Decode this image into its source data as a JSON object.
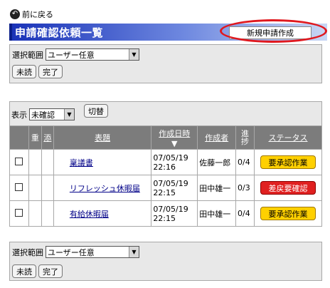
{
  "nav": {
    "back_label": "前に戻る"
  },
  "header": {
    "title": "申請確認依頼一覧",
    "new_button": "新規申請作成"
  },
  "top_panel": {
    "range_label": "選択範囲",
    "range_value": "ユーザー任意",
    "unread_button": "未読",
    "done_button": "完了"
  },
  "filter": {
    "label": "表示",
    "value": "未確認",
    "switch_button": "切替"
  },
  "table": {
    "headers": {
      "important": "重",
      "attach": "添",
      "subject": "表題",
      "created": "作成日時",
      "author": "作成者",
      "progress": "進捗",
      "status": "ステータス"
    },
    "rows": [
      {
        "subject": "稟議書",
        "date": "07/05/19",
        "time": "22:16",
        "author": "佐藤一郎",
        "progress": "0/4",
        "status": "要承認作業",
        "status_color": "#ffd000"
      },
      {
        "subject": "リフレッシュ休暇届",
        "date": "07/05/19",
        "time": "22:15",
        "author": "田中雄一",
        "progress": "0/3",
        "status": "差戻要確認",
        "status_color": "#e02020"
      },
      {
        "subject": "有給休暇届",
        "date": "07/05/19",
        "time": "22:15",
        "author": "田中雄一",
        "progress": "0/4",
        "status": "要承認作業",
        "status_color": "#ffd000"
      }
    ]
  },
  "bottom_panel": {
    "range_label": "選択範囲",
    "range_value": "ユーザー任意",
    "unread_button": "未読",
    "done_button": "完了"
  },
  "colors": {
    "title_gradient_start": "#1a33b8",
    "highlight_oval": "#e0181e",
    "header_bg": "#7c7c7c",
    "panel_bg": "#e8e8e8"
  }
}
